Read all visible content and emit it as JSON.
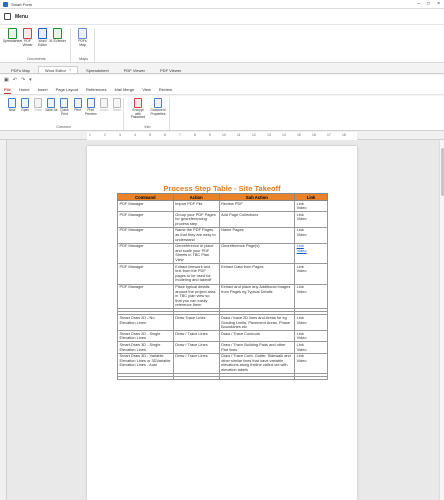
{
  "window": {
    "title": "Smart Form"
  },
  "menu": {
    "label": "Menu"
  },
  "ribbon_top": {
    "groups": [
      {
        "name": "Documents",
        "items": [
          {
            "label": "Spreadsheet",
            "icon": "spreadsheet-icon"
          },
          {
            "label": "PDF Viewer",
            "icon": "pdf-icon"
          },
          {
            "label": "Word Editor",
            "icon": "word-icon"
          },
          {
            "label": "XLSViewer",
            "icon": "xls-icon"
          }
        ]
      },
      {
        "name": "Maps",
        "items": [
          {
            "label": "PDFs Map",
            "icon": "map-icon"
          }
        ]
      }
    ]
  },
  "doc_tabs": [
    {
      "label": "PDFs Map",
      "active": false
    },
    {
      "label": "Word Editor",
      "active": true
    },
    {
      "label": "Spreadsheet",
      "active": false
    },
    {
      "label": "PDF Viewer",
      "active": false
    },
    {
      "label": "PDF Viewer",
      "active": false
    }
  ],
  "word_tabs": [
    "File",
    "Home",
    "Insert",
    "Page Layout",
    "References",
    "Mail Merge",
    "View",
    "Review"
  ],
  "word_ribbon": {
    "common": {
      "name": "Common",
      "items": [
        "New",
        "Open",
        "Save",
        "Save As",
        "Quick Print",
        "Print",
        "Print Preview",
        "Undo",
        "Redo"
      ]
    },
    "info": {
      "name": "Info",
      "items": [
        "Encrypt with Password",
        "Document Properties"
      ]
    }
  },
  "ruler": {
    "numbers": [
      "1",
      "2",
      "3",
      "4",
      "5",
      "6",
      "7",
      "8",
      "9",
      "10",
      "11",
      "12",
      "13",
      "14",
      "15",
      "16",
      "17",
      "18"
    ]
  },
  "document": {
    "title": "Process Step Table - Site Takeoff",
    "headers": [
      "Command",
      "Action",
      "Sub Action",
      "Link"
    ],
    "rows": [
      [
        "PDF Manager",
        "Import PDF File",
        "Review PDF",
        "Link\nVideo"
      ],
      [
        "PDF Manager",
        "Group your PDF Pages for georeferencing process step",
        "Add Page Collections",
        "Link\nVideo"
      ],
      [
        "PDF Manager",
        "Name the PDF Pages as that they are easy to understand",
        "Name Pages",
        "Link\nVideo"
      ],
      [
        "PDF Manager",
        "Georeference ie place and scale your PDF Sheets in TBC Plan View",
        "Georeference Page(s)",
        "Link\nVideo"
      ],
      [
        "PDF Manager",
        "Extract linework and text from the PDF pages to be used for modeling and takeoff",
        "Extract Data from Pages",
        "Link\nVideo"
      ],
      [
        "PDF Manager",
        "Place typical details around the project area in TBC plan view so that you can easily reference them",
        "Extract and place any Additional Images from Pages eg Typical Details",
        "Link\nVideo"
      ],
      [
        "Smart Draw 2D - No Elevation Lines",
        "Draw Trace Lines",
        "Draw / trace 2D lines and Areas for eg Grading Limits, Pavement Areas, Phase Boundaries etc",
        "Link\nVideo"
      ],
      [
        "Smart Draw 2D - Single Elevation Lines",
        "Draw / Trace Lines",
        "Draw / Trace Contours",
        "Link\nVideo"
      ],
      [
        "Smart Draw 3D - Single Elevation Lines",
        "Draw / Trace Lines",
        "Draw / Trace Building Pads and other Pad lines",
        "Link\nVideo"
      ],
      [
        "Smart Draw 3D - Variable Elevation Lines or 3DVariable Elevation Lines - Auto",
        "Draw / Trace Lines",
        "Draw / Trace Curb, Gutter, Sidewalk and other similar lines that have variable elevations along theline called out with elevation labels",
        "Link\nVideo"
      ]
    ]
  }
}
